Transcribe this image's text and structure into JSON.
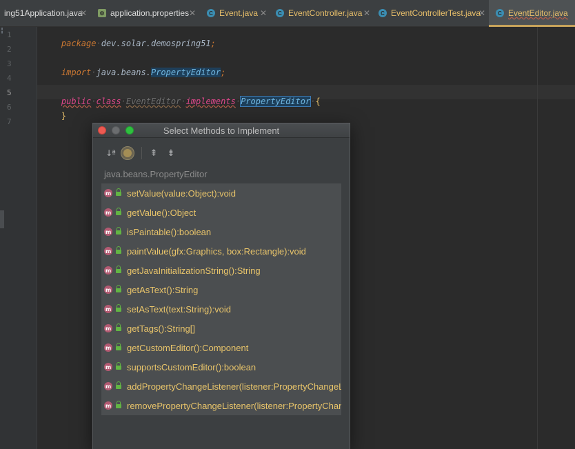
{
  "tabs": [
    {
      "label": "ing51Application.java",
      "icon": "none",
      "active": false
    },
    {
      "label": "application.properties",
      "icon": "properties-icon",
      "active": false
    },
    {
      "label": "Event.java",
      "icon": "class-icon",
      "active": false
    },
    {
      "label": "EventController.java",
      "icon": "class-icon",
      "active": false
    },
    {
      "label": "EventControllerTest.java",
      "icon": "class-icon",
      "active": false
    },
    {
      "label": "EventEditor.java",
      "icon": "class-icon",
      "active": true
    }
  ],
  "gutter": {
    "mark": "¦",
    "lines": [
      "1",
      "2",
      "3",
      "4",
      "5",
      "6",
      "7"
    ]
  },
  "code": {
    "line1": {
      "kw": "package",
      "rest": "dev.solar.demospring51",
      "end": ";"
    },
    "line3": {
      "kw": "import",
      "pkg": "java.beans.",
      "type": "PropertyEditor",
      "end": ";"
    },
    "line5": {
      "kw1": "public",
      "kw2": "class",
      "name": "EventEditor",
      "kw3": "implements",
      "type": "PropertyEditor",
      "brace": "{"
    },
    "line6": {
      "brace": "}"
    }
  },
  "dialog": {
    "title": "Select Methods to Implement",
    "toolbar": {
      "sort_label": "↓ª",
      "expand_all_glyph": "⇞",
      "collapse_all_glyph": "⇟"
    },
    "class_name": "java.beans.PropertyEditor",
    "method_badge": "m",
    "methods": [
      "setValue(value:Object):void",
      "getValue():Object",
      "isPaintable():boolean",
      "paintValue(gfx:Graphics, box:Rectangle):void",
      "getJavaInitializationString():String",
      "getAsText():String",
      "setAsText(text:String):void",
      "getTags():String[]",
      "getCustomEditor():Component",
      "supportsCustomEditor():boolean",
      "addPropertyChangeListener(listener:PropertyChangeListener):void",
      "removePropertyChangeListener(listener:PropertyChangeListener):void"
    ]
  },
  "colors": {
    "accent_tab": "#c7a35a",
    "method_text": "#e8c46a",
    "method_icon": "#b35a72",
    "lock": "#62b543"
  }
}
